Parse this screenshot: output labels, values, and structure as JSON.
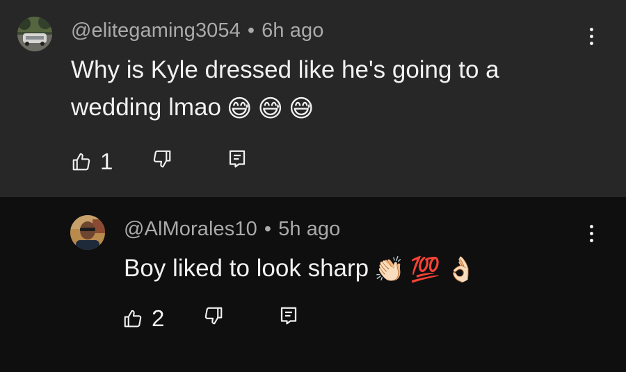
{
  "comments": [
    {
      "author": "@elitegaming3054",
      "separator": "•",
      "time": "6h ago",
      "text": "Why is Kyle dressed like he's going to a wedding lmao",
      "emojis": [
        "😅",
        "😅",
        "😅"
      ],
      "likes": "1"
    },
    {
      "author": "@AlMorales10",
      "separator": "•",
      "time": "5h ago",
      "text": "Boy liked to look sharp",
      "emojis": [
        "👏🏻",
        "💯",
        "👌🏻"
      ],
      "likes": "2"
    }
  ],
  "icons": {
    "like": "thumbs-up-icon",
    "dislike": "thumbs-down-icon",
    "reply": "reply-icon",
    "menu": "more-vert-icon"
  },
  "colors": {
    "top_bg": "#272727",
    "reply_bg": "#0f0f0f",
    "meta": "#aaaaaa",
    "text": "#f1f1f1"
  }
}
